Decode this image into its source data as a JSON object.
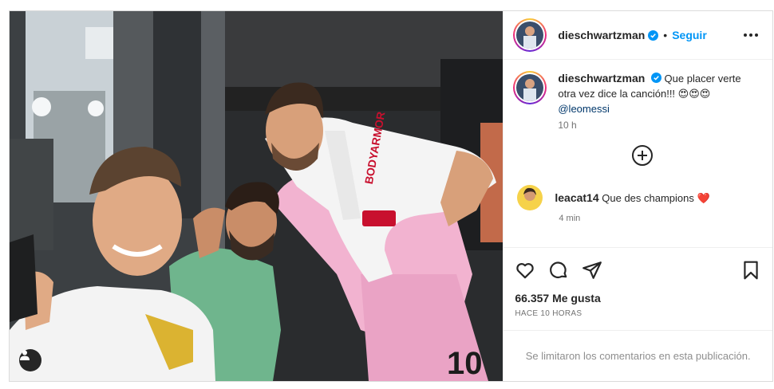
{
  "post": {
    "author": "dieschwartzman",
    "follow_label": "Seguir",
    "separator": "•",
    "caption_text": "Que placer verte otra vez dice la canción!!! 😍😍😍",
    "caption_mention": "@leomessi",
    "caption_time": "10 h",
    "comments": [
      {
        "user": "leacat14",
        "text": "Que des champions",
        "emoji": "❤️",
        "time": "4 min"
      }
    ],
    "likes": "66.357 Me gusta",
    "posted_ago": "HACE 10 HORAS",
    "comments_disabled": "Se limitaron los comentarios en esta publicación."
  },
  "colors": {
    "accent": "#0095f6",
    "verified": "#0095f6",
    "heart_red": "#ed4956",
    "pink_jersey": "#f2b3d0"
  },
  "icons": [
    "tag-user-icon",
    "verified-badge-icon",
    "more-options-icon",
    "load-more-comments-icon",
    "heart-icon",
    "comment-icon",
    "share-icon",
    "bookmark-icon"
  ]
}
